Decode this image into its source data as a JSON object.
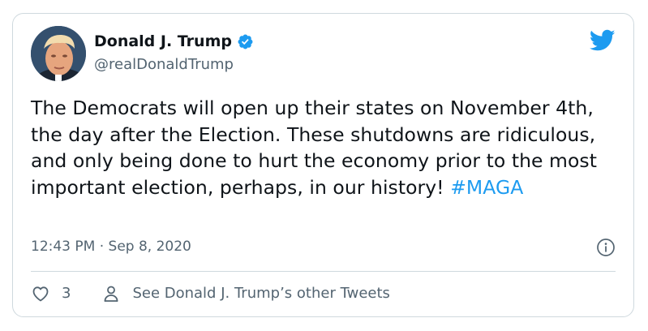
{
  "author": {
    "display_name": "Donald J. Trump",
    "handle": "@realDonaldTrump",
    "verified": true,
    "avatar_icon": "profile-photo"
  },
  "tweet": {
    "text_main": "The Democrats will open up their states on November 4th, the day after the Election. These shutdowns are ridiculous, and only being done to hurt the economy prior to the most important election, perhaps, in our history! ",
    "hashtag": "#MAGA",
    "timestamp": "12:43 PM · Sep 8, 2020"
  },
  "actions": {
    "like_count": "3",
    "profile_link_label": "See Donald J. Trump’s other Tweets"
  },
  "icons": {
    "brand": "twitter-bird-icon",
    "verified": "verified-badge-icon",
    "info": "info-icon",
    "like": "heart-icon",
    "profile": "person-icon"
  },
  "colors": {
    "accent": "#1d9bf0",
    "text": "#0f1419",
    "secondary_text": "#536471",
    "border": "#cfd9de"
  }
}
